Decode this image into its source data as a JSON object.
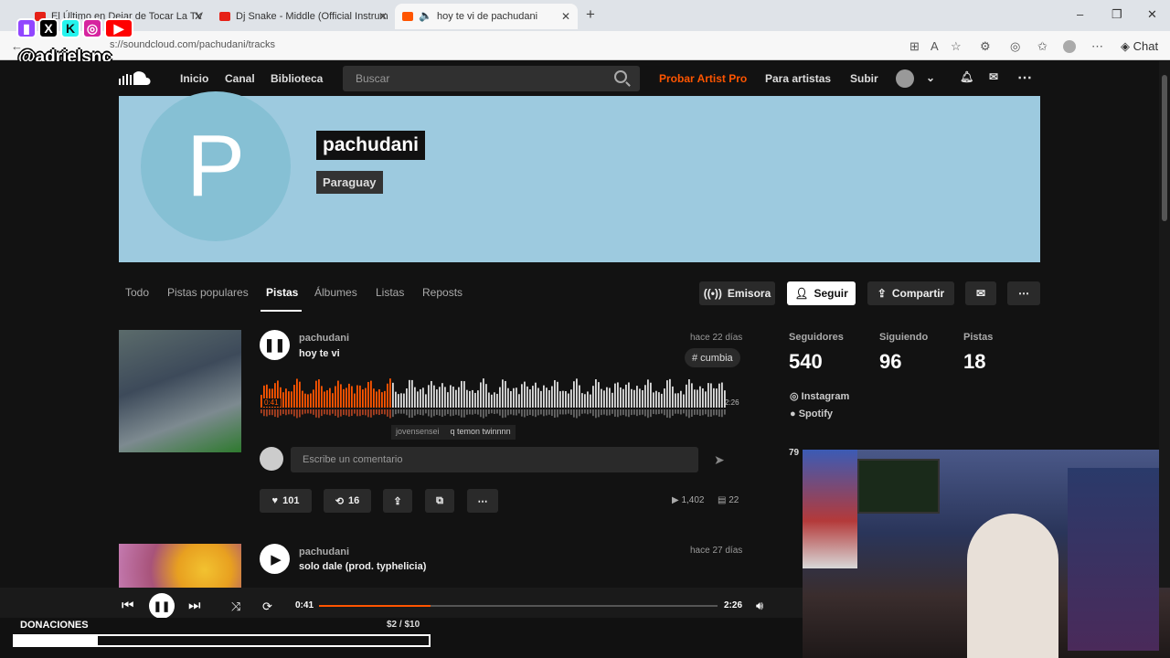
{
  "browser": {
    "tabs": [
      {
        "label": "El Último en Dejar de Tocar La TV",
        "color": "#e62117"
      },
      {
        "label": "Dj Snake - Middle (Official Instrum",
        "color": "#e62117"
      },
      {
        "label": "hoy te vi de pachudani",
        "color": "#ff5500"
      }
    ],
    "url": "s://soundcloud.com/pachudani/tracks",
    "chat_label": "Chat"
  },
  "overlay": {
    "handle": "@adrielsnc"
  },
  "header": {
    "nav": [
      "Inicio",
      "Canal",
      "Biblioteca"
    ],
    "search_placeholder": "Buscar",
    "try_pro": "Probar Artist Pro",
    "for_artists": "Para artistas",
    "upload": "Subir"
  },
  "profile": {
    "initial": "P",
    "name": "pachudani",
    "country": "Paraguay"
  },
  "subtabs": [
    "Todo",
    "Pistas populares",
    "Pistas",
    "Álbumes",
    "Listas",
    "Reposts"
  ],
  "profile_actions": {
    "station": "Emisora",
    "follow": "Seguir",
    "share": "Compartir"
  },
  "stats": {
    "followers_label": "Seguidores",
    "followers": "540",
    "following_label": "Siguiendo",
    "following": "96",
    "tracks_label": "Pistas",
    "tracks": "18"
  },
  "social_links": [
    "Instagram",
    "Spotify"
  ],
  "tracks": [
    {
      "artist": "pachudani",
      "title": "hoy te vi",
      "date": "hace 22 días",
      "tag": "# cumbia",
      "current_time": "0:41",
      "duration": "2:26",
      "comment_user": "jovensensei",
      "comment_text": "q temon twinnnn",
      "comment_placeholder": "Escribe un comentario",
      "likes": "101",
      "reposts": "16",
      "plays": "1,402",
      "comments": "22"
    },
    {
      "artist": "pachudani",
      "title": "solo dale (prod. typhelicia)",
      "date": "hace 27 días"
    }
  ],
  "player": {
    "elapsed": "0:41",
    "total": "2:26",
    "progress": 0.28
  },
  "donations": {
    "label": "DONACIONES",
    "amount": "$2 / $10"
  },
  "side_count": "79",
  "colors": {
    "accent": "#ff5500",
    "hero_bg": "#9dcadf",
    "page_bg": "#121212"
  }
}
